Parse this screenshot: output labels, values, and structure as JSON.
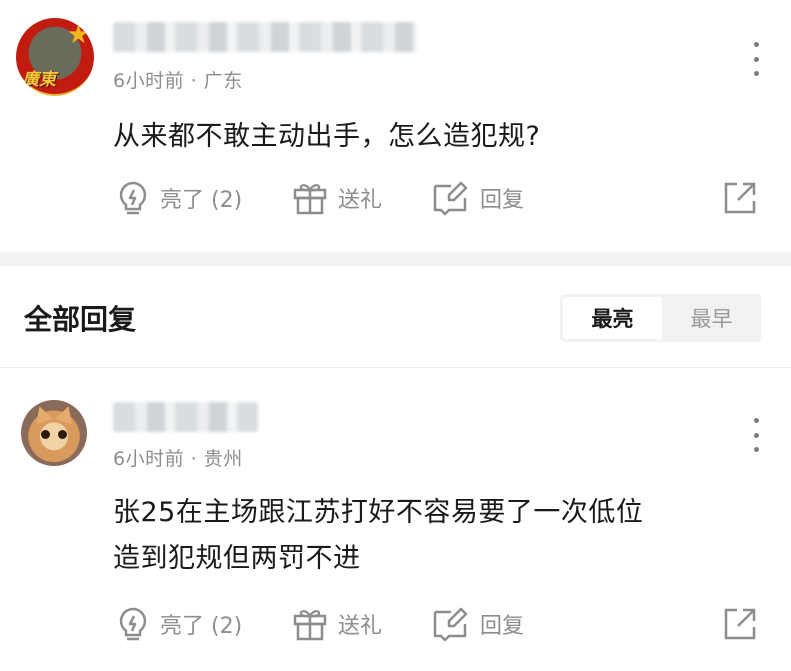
{
  "top_comment": {
    "avatar_text": "廣東",
    "time": "6小时前",
    "location": "广东",
    "text": "从来都不敢主动出手，怎么造犯规?",
    "actions": {
      "like": "亮了 (2)",
      "gift": "送礼",
      "reply": "回复"
    }
  },
  "replies_section": {
    "title": "全部回复",
    "sort_options": [
      "最亮",
      "最早"
    ],
    "active_sort": "最亮"
  },
  "reply_comment": {
    "time": "6小时前",
    "location": "贵州",
    "text_line1": "张25在主场跟江苏打好不容易要了一次低位",
    "text_line2": "造到犯规但两罚不进",
    "actions": {
      "like": "亮了 (2)",
      "gift": "送礼",
      "reply": "回复"
    }
  },
  "icons": [
    "lightbulb-icon",
    "gift-icon",
    "edit-reply-icon",
    "share-icon",
    "more-vertical-icon"
  ],
  "colors": {
    "text": "#1a1a1a",
    "muted": "#8d8d8d",
    "band": "#f1f2f4"
  }
}
